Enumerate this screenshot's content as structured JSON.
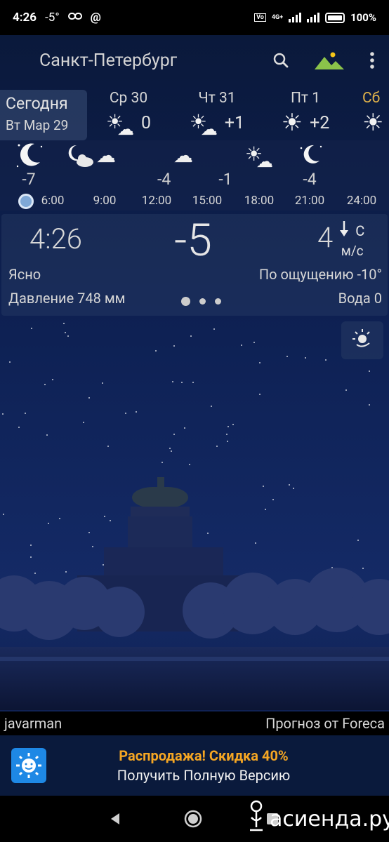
{
  "status_bar": {
    "time": "4:26",
    "temp": "-5°",
    "network": "4G+",
    "battery": "100%"
  },
  "app_bar": {
    "city": "Санкт-Петербург",
    "icons": [
      "search-icon",
      "landscape-icon",
      "more-vert-icon"
    ],
    "landscape_color": "#8bc34a"
  },
  "days": {
    "today": {
      "label": "Сегодня",
      "date": "Вт Мар 29"
    },
    "items": [
      {
        "name": "Ср 30",
        "temp": "0",
        "icon": "sun-cloud"
      },
      {
        "name": "Чт 31",
        "temp": "+1",
        "icon": "sun-cloud"
      },
      {
        "name": "Пт 1",
        "temp": "+2",
        "icon": "sun"
      },
      {
        "name": "Сб",
        "temp": "",
        "icon": "sun"
      }
    ],
    "partial_color": "#e3b44a"
  },
  "hourly": {
    "items": [
      {
        "time": "6:00",
        "temp": "-7",
        "icon": "moon-stars"
      },
      {
        "time": "9:00",
        "temp": "",
        "icon": "moon-cloud"
      },
      {
        "time": "12:00",
        "temp": "-4",
        "icon": "cloud"
      },
      {
        "time": "15:00",
        "temp": "",
        "icon": "cloud"
      },
      {
        "time": "18:00",
        "temp": "-1",
        "icon": "sun-cloud"
      },
      {
        "time": "21:00",
        "temp": "",
        "icon": "sun-cloud"
      },
      {
        "time": "24:00",
        "temp": "-4",
        "icon": "moon-stars"
      }
    ]
  },
  "current": {
    "time": "4:26",
    "temp": "-5",
    "wind_speed": "4",
    "wind_dir": "С",
    "wind_unit": "м/с",
    "description": "Ясно",
    "feels_like": "По ощущению -10°",
    "pressure": "Давление 748 мм",
    "water": "Вода 0"
  },
  "footer": {
    "author": "javarman",
    "provider": "Прогноз от Foreca"
  },
  "promo": {
    "title": "Распродажа! Скидка 40%",
    "subtitle": "Получить Полную Версию",
    "title_color": "#f5a623"
  },
  "watermark": {
    "text": "асиенда.ру"
  }
}
